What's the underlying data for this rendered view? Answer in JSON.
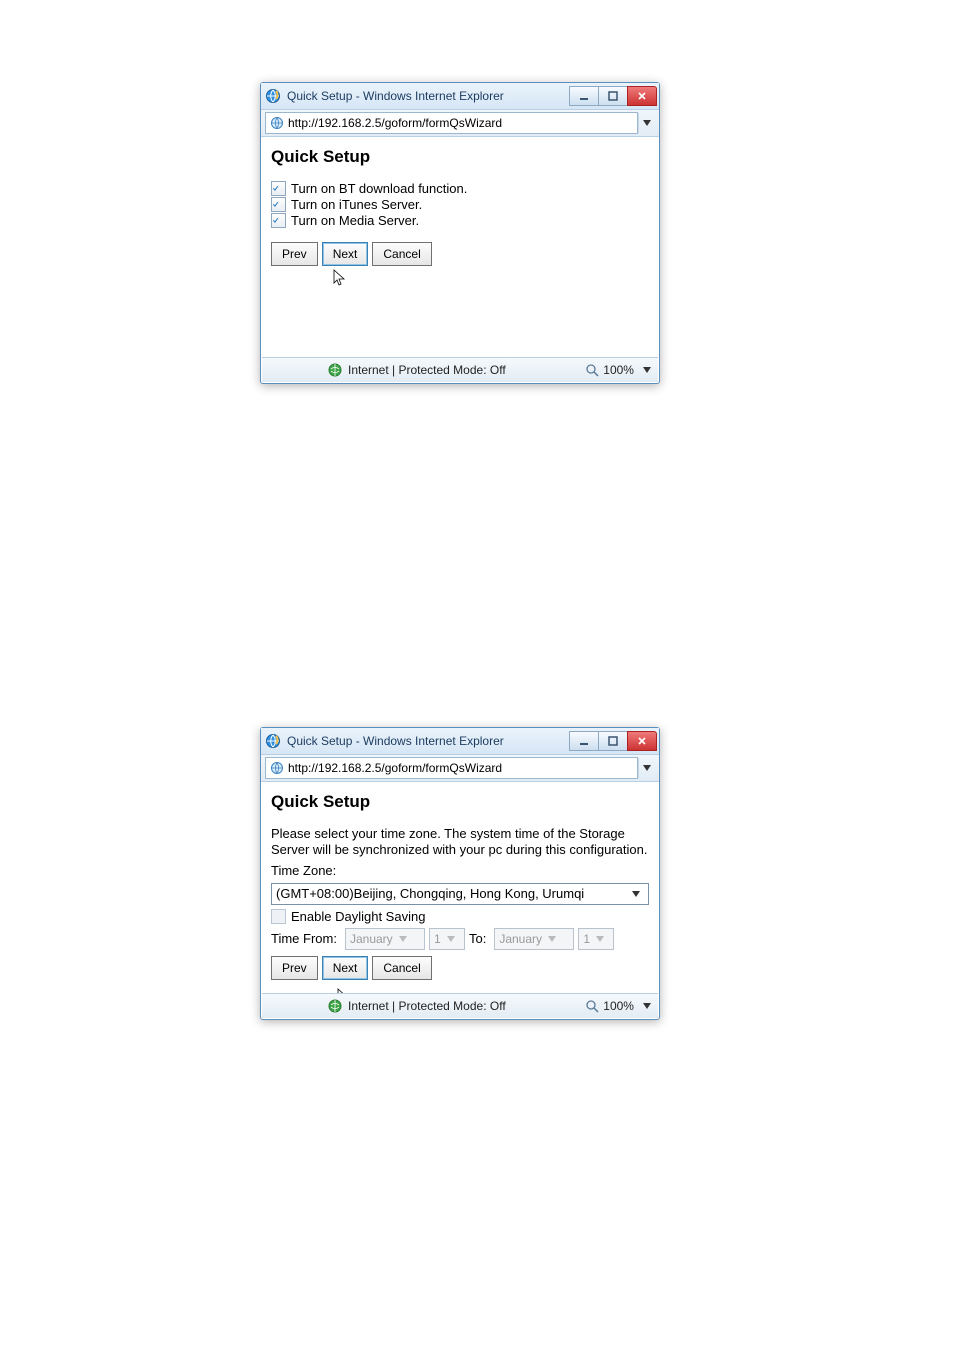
{
  "windows": [
    {
      "title": "Quick Setup - Windows Internet Explorer",
      "url": "http://192.168.2.5/goform/formQsWizard",
      "heading": "Quick Setup",
      "options": [
        {
          "label": "Turn on BT download function.",
          "checked": true
        },
        {
          "label": "Turn on iTunes Server.",
          "checked": true
        },
        {
          "label": "Turn on Media Server.",
          "checked": true
        }
      ],
      "buttons": {
        "prev": "Prev",
        "next": "Next",
        "cancel": "Cancel"
      },
      "status": {
        "mode": "Internet | Protected Mode: Off",
        "zoom": "100%"
      }
    },
    {
      "title": "Quick Setup - Windows Internet Explorer",
      "url": "http://192.168.2.5/goform/formQsWizard",
      "heading": "Quick Setup",
      "prose": "Please select your time zone. The system time of the Storage Server will be synchronized with your pc during this configuration.",
      "tz_label": "Time Zone:",
      "tz_value": "(GMT+08:00)Beijing, Chongqing, Hong Kong, Urumqi",
      "daylight": {
        "label": "Enable Daylight Saving",
        "checked": false
      },
      "time_from_label": "Time From:",
      "to_label": "To:",
      "from_month": "January",
      "from_day": "1",
      "to_month": "January",
      "to_day": "1",
      "buttons": {
        "prev": "Prev",
        "next": "Next",
        "cancel": "Cancel"
      },
      "status": {
        "mode": "Internet | Protected Mode: Off",
        "zoom": "100%"
      }
    }
  ]
}
